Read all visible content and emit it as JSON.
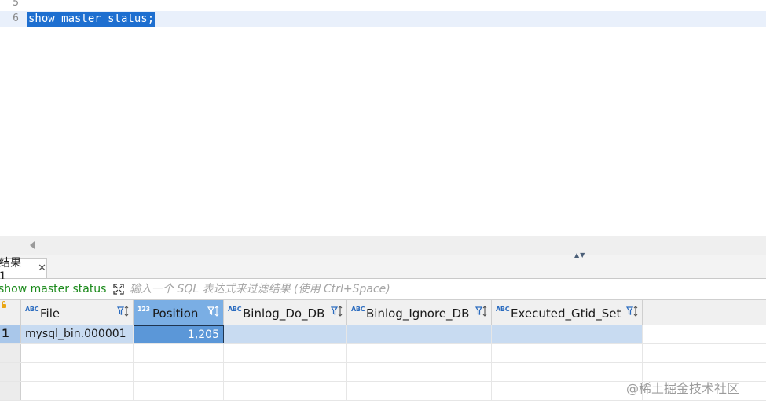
{
  "editor": {
    "line_numbers": [
      "5",
      "6"
    ],
    "code": "show master status;"
  },
  "results": {
    "tab_label": "结果 1",
    "tab_close": "✕",
    "query_name": "show master status",
    "filter_placeholder": "输入一个 SQL 表达式来过滤结果 (使用 Ctrl+Space)",
    "panel_arrows": "▲▼",
    "columns": [
      {
        "type_badge": "ABC",
        "name": "File"
      },
      {
        "type_badge": "123",
        "name": "Position"
      },
      {
        "type_badge": "ABC",
        "name": "Binlog_Do_DB"
      },
      {
        "type_badge": "ABC",
        "name": "Binlog_Ignore_DB"
      },
      {
        "type_badge": "ABC",
        "name": "Executed_Gtid_Set"
      }
    ],
    "rows": [
      {
        "num": "1",
        "cells": [
          "mysql_bin.000001",
          "1,205",
          "",
          "",
          ""
        ]
      }
    ]
  },
  "watermark": "@稀土掘金技术社区",
  "colors": {
    "selection": "#1e6fd0",
    "selected_header": "#7aaee4",
    "active_cell": "#5b97d8",
    "row_highlight": "#c8dbf1",
    "query_green": "#1b8a1b"
  },
  "icons": {
    "expand": "expand-icon",
    "sort_filter": "sort-filter-icon",
    "lock": "lock-icon"
  }
}
